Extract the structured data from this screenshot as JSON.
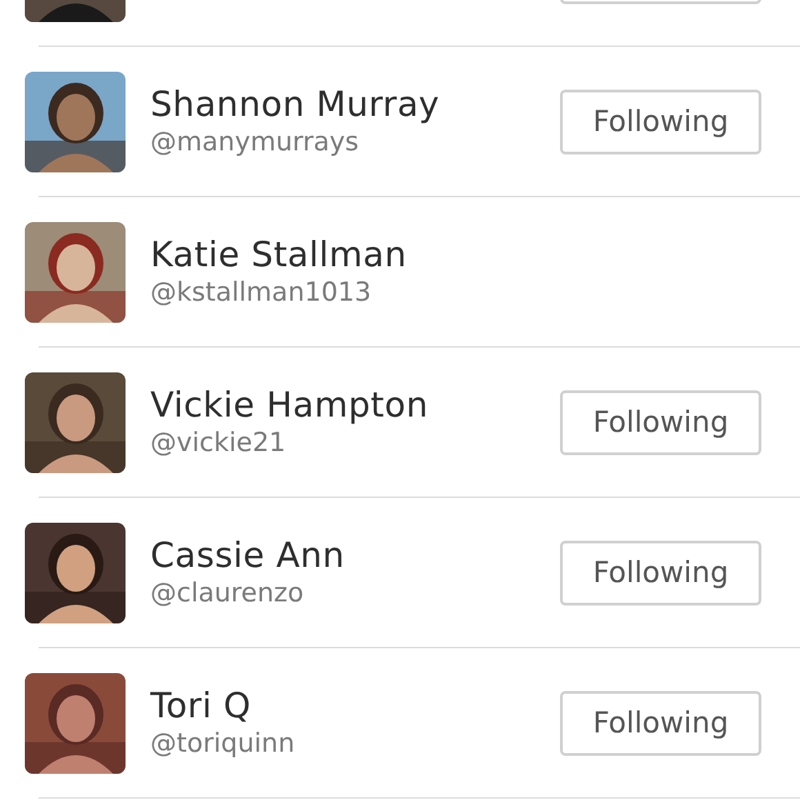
{
  "users": [
    {
      "following": true
    },
    {
      "name": "Shannon Murray",
      "handle": "@manymurrays",
      "following": true,
      "button": "Following"
    },
    {
      "name": "Katie Stallman",
      "handle": "@kstallman1013",
      "following": false
    },
    {
      "name": "Vickie Hampton",
      "handle": "@vickie21",
      "following": true,
      "button": "Following"
    },
    {
      "name": "Cassie Ann",
      "handle": "@claurenzo",
      "following": true,
      "button": "Following"
    },
    {
      "name": "Tori Q",
      "handle": "@toriquinn",
      "following": true,
      "button": "Following"
    }
  ]
}
